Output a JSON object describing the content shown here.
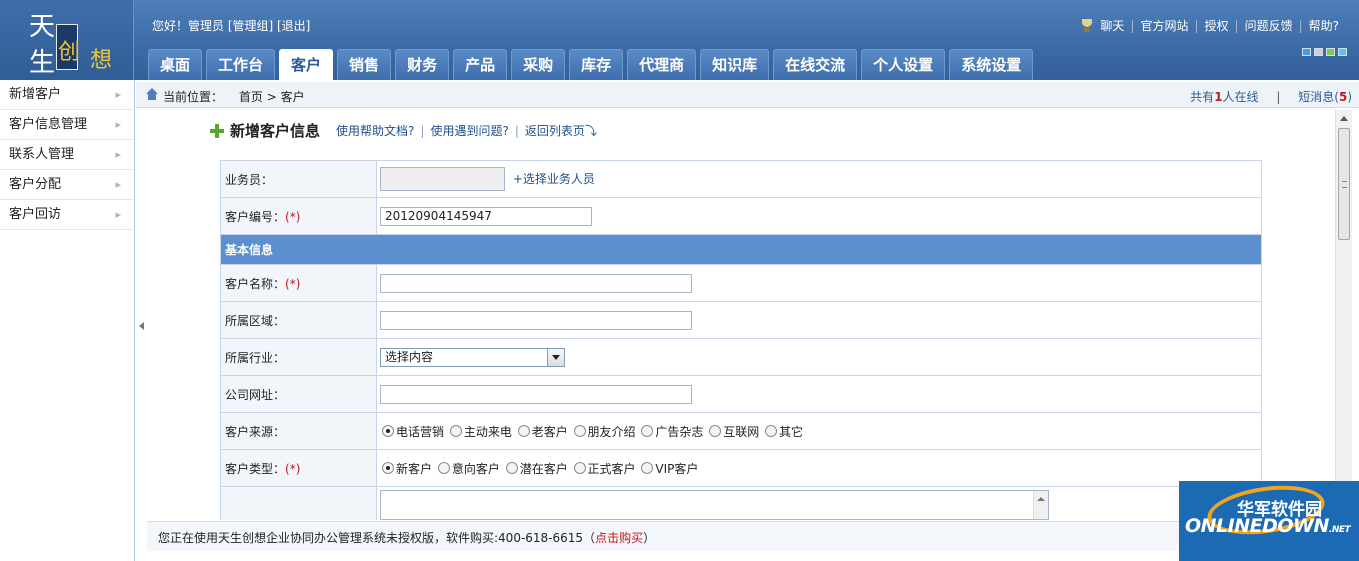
{
  "logo": {
    "text": "天生创想",
    "c1": "天",
    "c2": "生",
    "c3": "创",
    "c4": "想"
  },
  "header": {
    "greeting": "您好！管理员 [管理组] [退出]",
    "links": [
      "聊天",
      "官方网站",
      "授权",
      "问题反馈",
      "帮助?"
    ],
    "skin_colors": [
      "#3f9ee8",
      "#cfcfcf",
      "#7dd04a",
      "#5bc3e8"
    ]
  },
  "nav": {
    "tabs": [
      "桌面",
      "工作台",
      "客户",
      "销售",
      "财务",
      "产品",
      "采购",
      "库存",
      "代理商",
      "知识库",
      "在线交流",
      "个人设置",
      "系统设置"
    ],
    "active": "客户"
  },
  "sidebar": {
    "items": [
      "新增客户",
      "客户信息管理",
      "联系人管理",
      "客户分配",
      "客户回访"
    ]
  },
  "breadcrumb": {
    "label": "当前位置：",
    "home": "首页",
    "sep": ">",
    "current": "客户"
  },
  "online": {
    "prefix": "共有",
    "count": "1",
    "suffix": "人在线",
    "divider": "|",
    "msg_label": "短消息(",
    "msg_count": "5",
    "msg_close": ")"
  },
  "form": {
    "title": "新增客户信息",
    "links": [
      "使用帮助文档?",
      "使用遇到问题?",
      "返回列表页"
    ],
    "salesman_label": "业务员：",
    "salesman_value": "",
    "salesman_pick": "+选择业务人员",
    "code_label": "客户编号：",
    "code_value": "20120904145947",
    "required_mark": "(*)",
    "section_basic": "基本信息",
    "name_label": "客户名称：",
    "region_label": "所属区域：",
    "industry_label": "所属行业：",
    "industry_value": "选择内容",
    "website_label": "公司网址：",
    "source_label": "客户来源：",
    "source_options": [
      "电话营销",
      "主动来电",
      "老客户",
      "朋友介绍",
      "广告杂志",
      "互联网",
      "其它"
    ],
    "source_selected": "电话营销",
    "type_label": "客户类型：",
    "type_options": [
      "新客户",
      "意向客户",
      "潜在客户",
      "正式客户",
      "VIP客户"
    ],
    "type_selected": "新客户"
  },
  "footer": {
    "notice": "您正在使用天生创想企业协同办公管理系统未授权版，软件购买:400-618-6615（",
    "buy": "点击购买",
    "close": "）"
  },
  "watermark": {
    "cn": "华军软件园",
    "en": "ONLINEDOWN",
    "net": ".NET"
  }
}
